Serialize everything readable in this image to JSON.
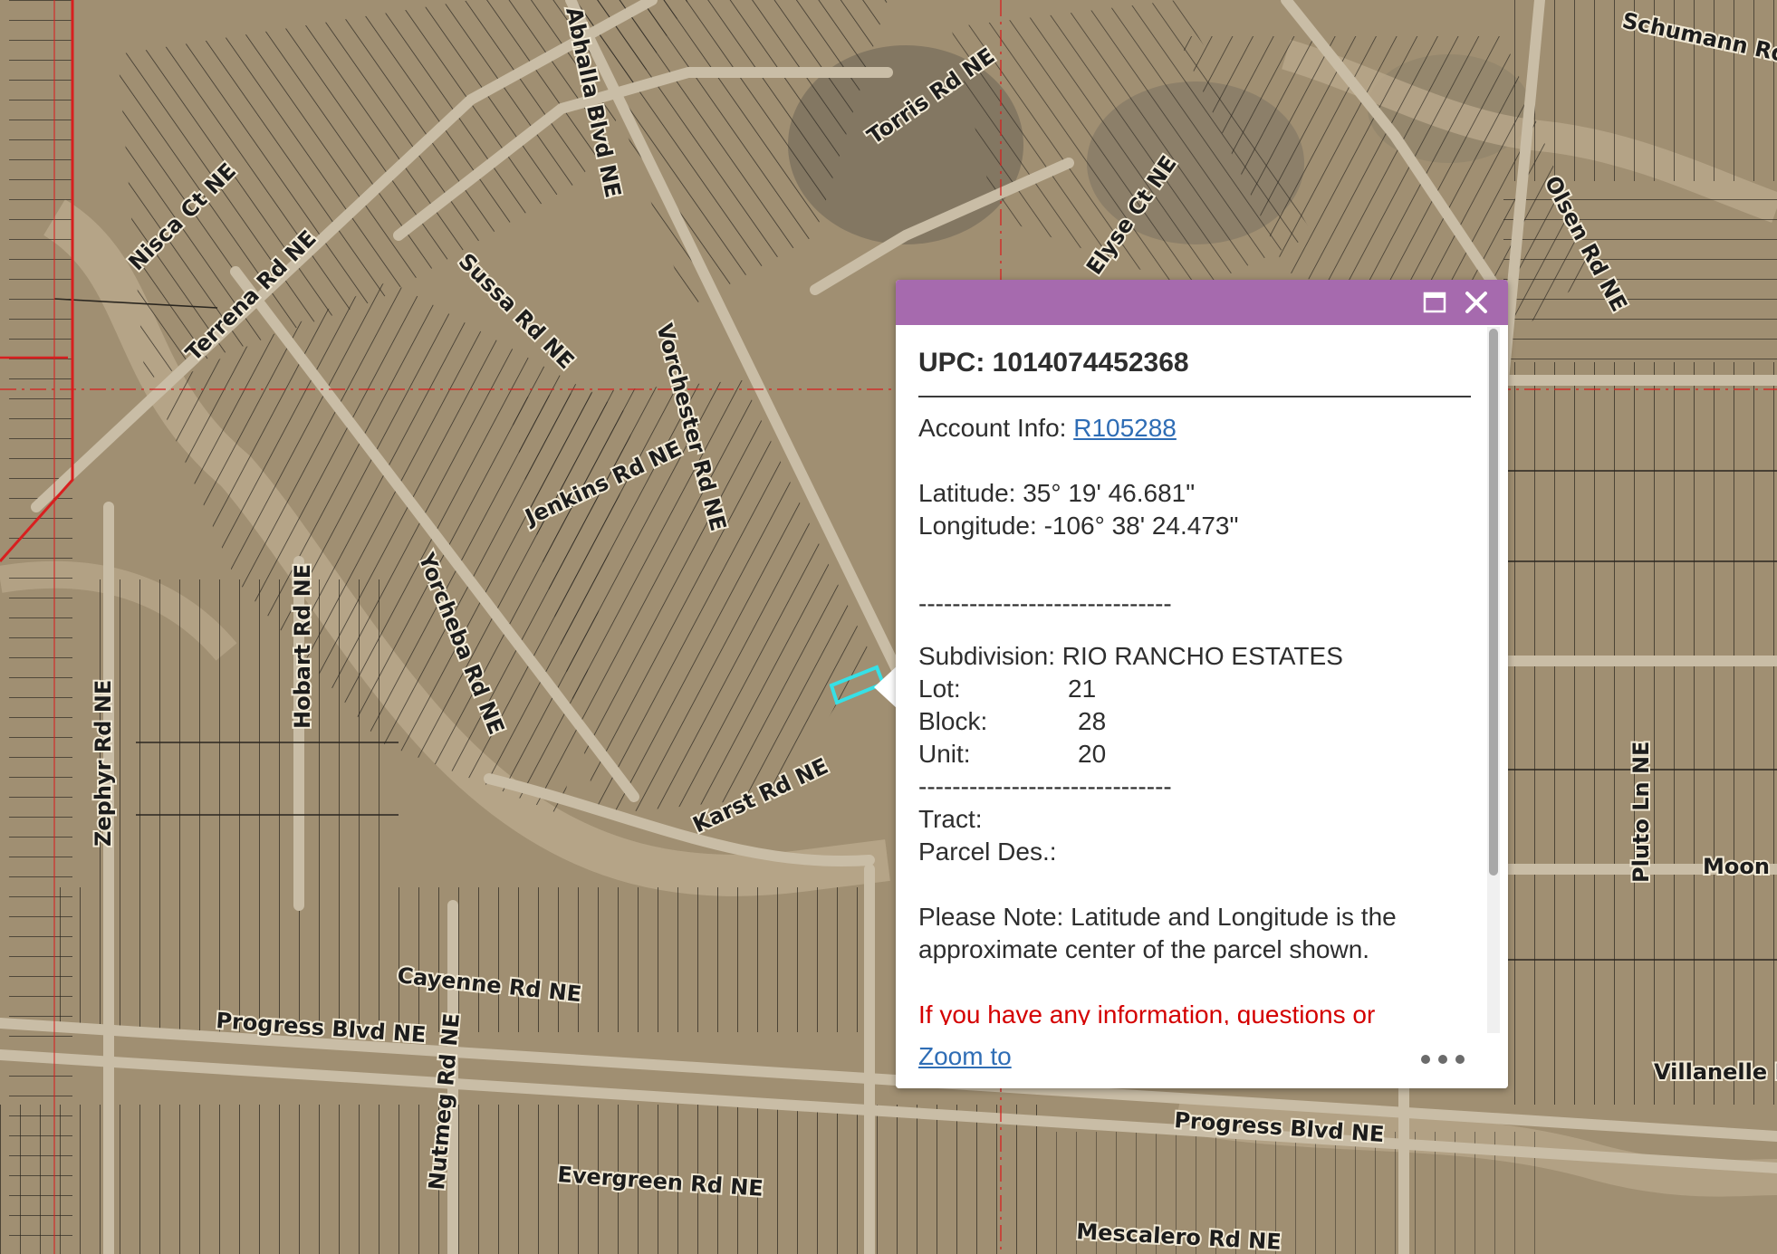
{
  "map": {
    "parcel_outline_color": "#36e0e6",
    "boundary_color": "#d81f1f",
    "road_labels": [
      "Nisca Ct NE",
      "Terrena Rd NE",
      "Sussa Rd NE",
      "Abhalla Blvd NE",
      "Torris Rd NE",
      "Jenkins Rd NE",
      "Vorchester Rd NE",
      "Yorcheba Rd NE",
      "Hobart Rd NE",
      "Zephyr Rd NE",
      "Karst Rd NE",
      "Cayenne Rd NE",
      "Progress Blvd NE",
      "Nutmeg Rd NE",
      "Evergreen Rd NE",
      "Progress Blvd NE",
      "Mescalero Rd NE",
      "Olsen Rd NE",
      "Elyse Ct NE",
      "Villanelle Rd",
      "Moon Rd",
      "Pluto Ln NE",
      "Schumann Rd"
    ]
  },
  "popup": {
    "header_color": "#a66aae",
    "maximize_icon": "maximize-icon",
    "close_icon": "close-icon",
    "upc": "UPC: 1014074452368",
    "account_label": "Account Info: ",
    "account_link": "R105288",
    "latitude": "Latitude: 35° 19' 46.681\"",
    "longitude": "Longitude: -106° 38' 24.473\"",
    "divider": "------------------------------",
    "subdivision": "Subdivision: RIO RANCHO ESTATES",
    "lot_label": "Lot:",
    "lot_value": "21",
    "block_label": "Block:",
    "block_value": "28",
    "unit_label": "Unit:",
    "unit_value": "20",
    "tract_label": "Tract:",
    "parcel_des_label": "Parcel Des.:",
    "note": "Please Note: Latitude and Longitude is the approximate center of the parcel shown.",
    "contact": "If you have any information, questions or concerns about this parcel please contact",
    "zoom_to": "Zoom to",
    "more_icon": "more-options-icon"
  }
}
